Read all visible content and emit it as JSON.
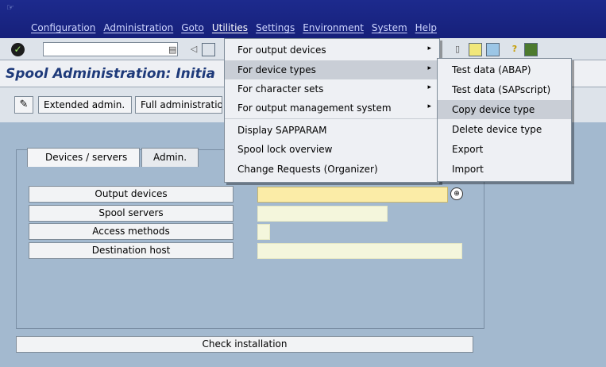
{
  "menubar": {
    "items": [
      "Configuration",
      "Administration",
      "Goto",
      "Utilities",
      "Settings",
      "Environment",
      "System",
      "Help"
    ],
    "active": "Utilities"
  },
  "toolbar": {
    "ok_icon": "check-icon",
    "command_field_value": ""
  },
  "title": "Spool Administration: Initia",
  "app_toolbar": {
    "pencil_icon": "pencil-icon",
    "buttons": [
      "Extended admin.",
      "Full administratio"
    ]
  },
  "tabs": [
    "Devices / servers",
    "Admin."
  ],
  "object_buttons": [
    "Output devices",
    "Spool servers",
    "Access methods",
    "Destination host"
  ],
  "check_installation_label": "Check installation",
  "utilities_menu": {
    "items": [
      {
        "label": "For output devices",
        "has_submenu": true
      },
      {
        "label": "For device types",
        "has_submenu": true,
        "highlighted": true
      },
      {
        "label": "For character sets",
        "has_submenu": true
      },
      {
        "label": "For output management system",
        "has_submenu": true
      },
      {
        "label": "Display SAPPARAM",
        "has_submenu": false
      },
      {
        "label": "Spool lock overview",
        "has_submenu": false
      },
      {
        "label": "Change Requests (Organizer)",
        "has_submenu": false
      }
    ]
  },
  "device_types_submenu": {
    "items": [
      {
        "label": "Test data (ABAP)"
      },
      {
        "label": "Test data (SAPscript)"
      },
      {
        "label": "Copy device type",
        "highlighted": true
      },
      {
        "label": "Delete device type"
      },
      {
        "label": "Export"
      },
      {
        "label": "Import"
      }
    ]
  },
  "colors": {
    "menubar": "#1d2a8d",
    "background": "#a3b9cf",
    "title": "#1e3a7a",
    "input_highlight": "#fbeca7",
    "menu_highlight": "#c9ced6"
  }
}
